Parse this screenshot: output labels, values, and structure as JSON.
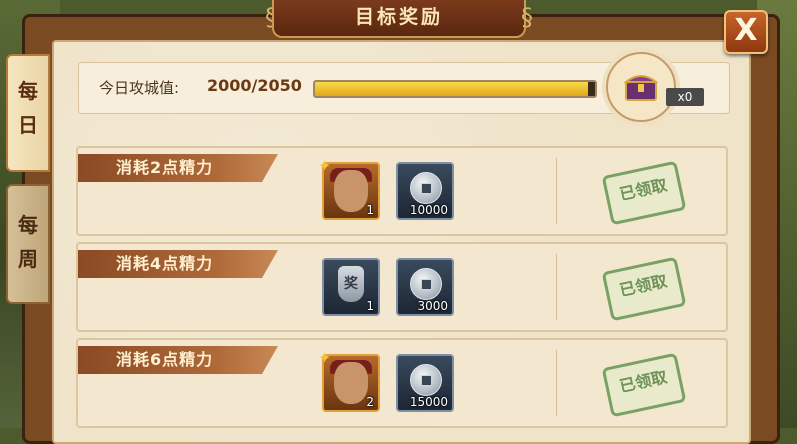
{
  "title": "目标奖励",
  "close_label": "X",
  "tabs": [
    {
      "label": "每日",
      "active": true
    },
    {
      "label": "每周",
      "active": false
    }
  ],
  "progress": {
    "label": "今日攻城值:",
    "value_text": "2000/2050",
    "fraction": 0.976,
    "chest_count": "x0"
  },
  "tasks": [
    {
      "banner": "消耗2点精力",
      "rewards": [
        {
          "icon": "hero-portrait-icon",
          "count": "1"
        },
        {
          "icon": "silver-coin-icon",
          "count": "10000"
        }
      ],
      "status": "已领取"
    },
    {
      "banner": "消耗4点精力",
      "rewards": [
        {
          "icon": "reward-token-icon",
          "token_text": "奖",
          "count": "1"
        },
        {
          "icon": "silver-coin-icon",
          "count": "3000"
        }
      ],
      "status": "已领取"
    },
    {
      "banner": "消耗6点精力",
      "rewards": [
        {
          "icon": "hero-portrait-icon",
          "count": "2"
        },
        {
          "icon": "silver-coin-icon",
          "count": "15000"
        }
      ],
      "status": "已领取"
    }
  ],
  "colors": {
    "bar_fill": "#e0a81a",
    "stamp": "#5f8a4c",
    "title_plate": "#7b3a1c"
  }
}
